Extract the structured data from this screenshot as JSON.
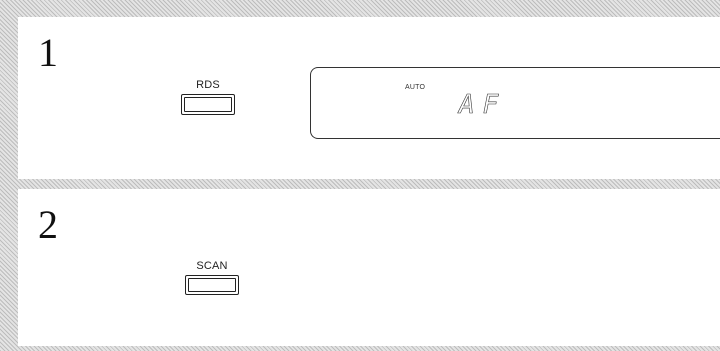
{
  "steps": [
    {
      "number": "1",
      "button_label": "RDS",
      "display": {
        "indicator": "AUTO",
        "text": "AF"
      }
    },
    {
      "number": "2",
      "button_label": "SCAN"
    }
  ]
}
